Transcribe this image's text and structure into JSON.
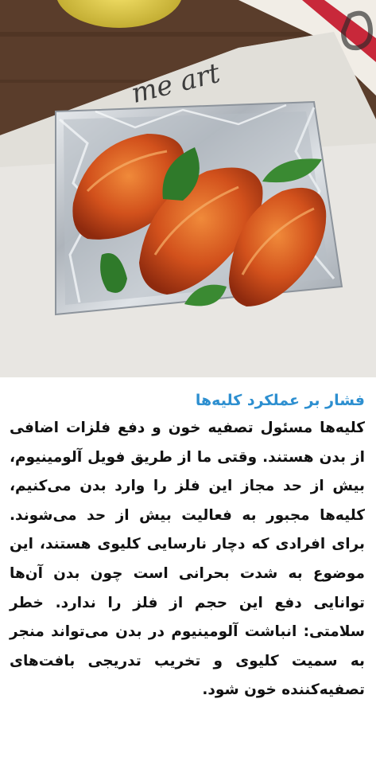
{
  "article": {
    "title": "فشار بر عملکرد کلیه‌ها",
    "body": "کلیه‌ها مسئول تصفیه خون و دفع فلزات اضافی از بدن هستند. وقتی ما از طریق فویل آلومینیوم، بیش از حد مجاز این فلز را وارد بدن می‌کنیم، کلیه‌ها مجبور به فعالیت بیش از حد می‌شوند. برای افرادی که دچار نارسایی کلیوی هستند، این موضوع به شدت بحرانی است چون بدن آن‌ها توانایی دفع این حجم از فلز را ندارد. خطر سلامتی: انباشت آلومینیوم در بدن می‌تواند منجر به سمیت کلیوی و تخریب تدریجی بافت‌های تصفیه‌کننده خون شود."
  },
  "photo": {
    "cloth_print": "me art",
    "colors": {
      "title": "#2d8fd0",
      "cloth": "#e8e6e2",
      "table": "#5a3d2b",
      "stripe": "#c8283a",
      "foil": "#c9cdd2",
      "glaze": "#c8421a",
      "mint": "#2f7a2a"
    }
  }
}
